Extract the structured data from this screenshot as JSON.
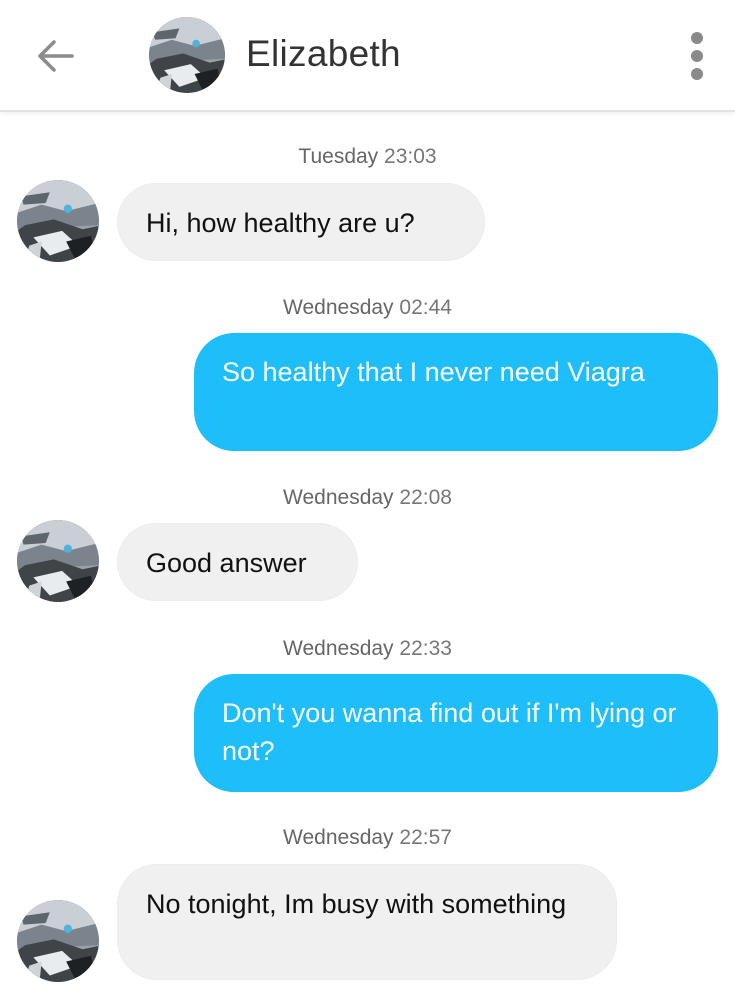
{
  "header": {
    "contact_name": "Elizabeth",
    "back_icon": "arrow-left-icon",
    "menu_icon": "more-vertical-icon"
  },
  "colors": {
    "outgoing_bubble": "#1ebefa",
    "incoming_bubble": "#f0f0f0",
    "timestamp_text": "#777777"
  },
  "messages": [
    {
      "day": "Tuesday",
      "time": "23:03",
      "direction": "incoming",
      "text": "Hi, how healthy are u?"
    },
    {
      "day": "Wednesday",
      "time": "02:44",
      "direction": "outgoing",
      "text": "So healthy that I never need Viagra"
    },
    {
      "day": "Wednesday",
      "time": "22:08",
      "direction": "incoming",
      "text": "Good answer"
    },
    {
      "day": "Wednesday",
      "time": "22:33",
      "direction": "outgoing",
      "text": "Don't you wanna find out if I'm lying or not?"
    },
    {
      "day": "Wednesday",
      "time": "22:57",
      "direction": "incoming",
      "text": "No tonight, Im busy with something"
    }
  ]
}
